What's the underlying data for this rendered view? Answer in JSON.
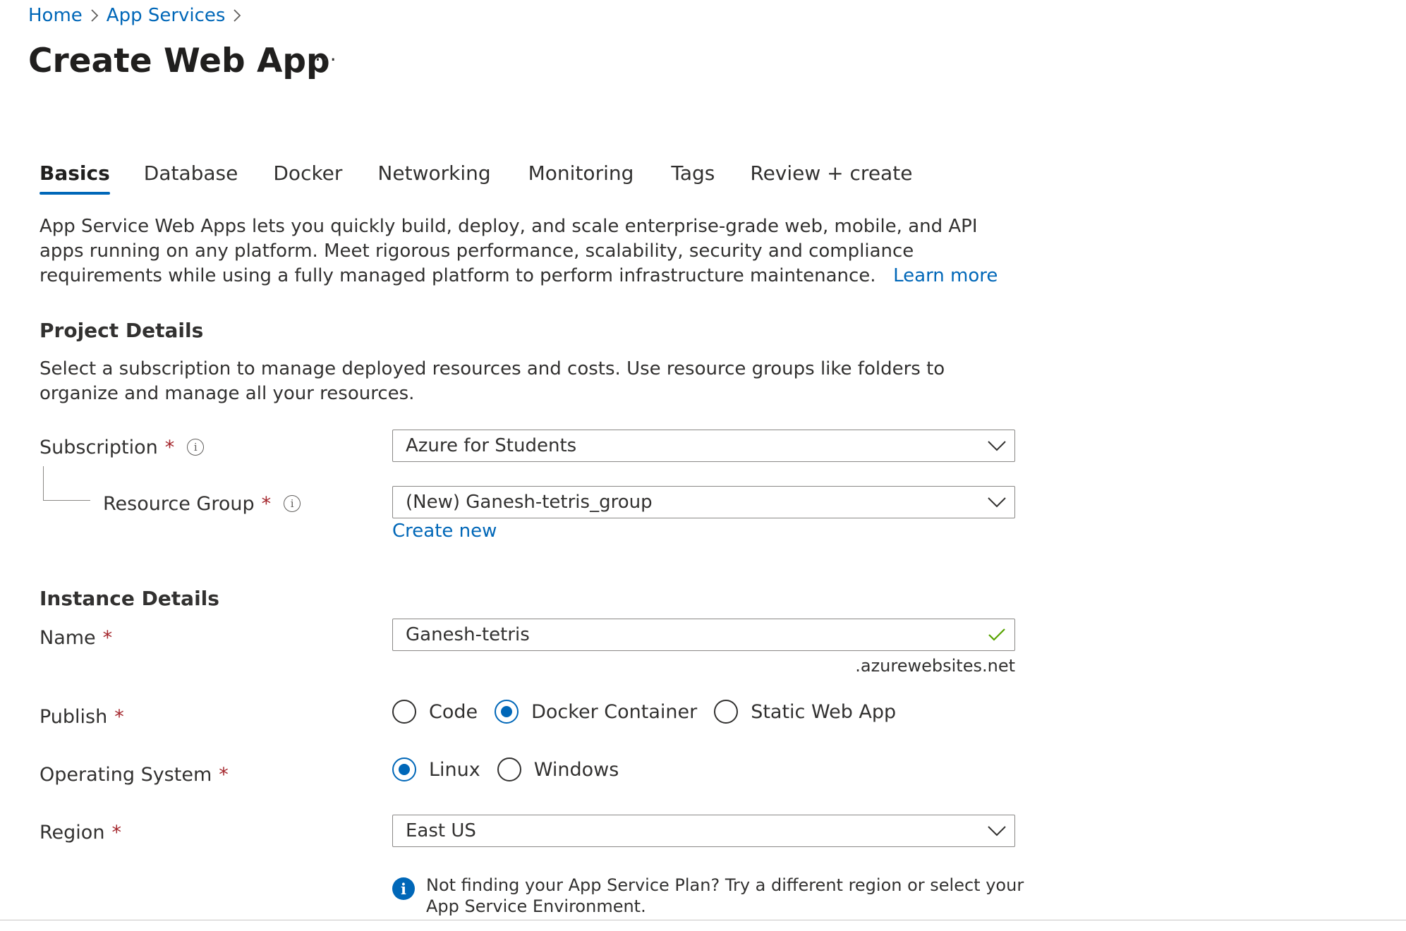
{
  "breadcrumb": {
    "home": "Home",
    "app_services": "App Services"
  },
  "page": {
    "title": "Create Web App",
    "more": "···"
  },
  "tabs": [
    {
      "label": "Basics",
      "active": true
    },
    {
      "label": "Database"
    },
    {
      "label": "Docker"
    },
    {
      "label": "Networking"
    },
    {
      "label": "Monitoring"
    },
    {
      "label": "Tags"
    },
    {
      "label": "Review + create"
    }
  ],
  "intro": {
    "text": "App Service Web Apps lets you quickly build, deploy, and scale enterprise-grade web, mobile, and API apps running on any platform. Meet rigorous performance, scalability, security and compliance requirements while using a fully managed platform to perform infrastructure maintenance.",
    "learn_more": "Learn more"
  },
  "project": {
    "heading": "Project Details",
    "description": "Select a subscription to manage deployed resources and costs. Use resource groups like folders to organize and manage all your resources.",
    "subscription": {
      "label": "Subscription",
      "required": "*",
      "value": "Azure for Students"
    },
    "resource_group": {
      "label": "Resource Group",
      "required": "*",
      "value": "(New) Ganesh-tetris_group",
      "create_new": "Create new"
    }
  },
  "instance": {
    "heading": "Instance Details",
    "name": {
      "label": "Name",
      "required": "*",
      "value": "Ganesh-tetris",
      "suffix": ".azurewebsites.net"
    },
    "publish": {
      "label": "Publish",
      "required": "*",
      "options": [
        "Code",
        "Docker Container",
        "Static Web App"
      ],
      "selected": "Docker Container"
    },
    "os": {
      "label": "Operating System",
      "required": "*",
      "options": [
        "Linux",
        "Windows"
      ],
      "selected": "Linux"
    },
    "region": {
      "label": "Region",
      "required": "*",
      "value": "East US"
    },
    "info_note": "Not finding your App Service Plan? Try a different region or select your App Service Environment."
  },
  "colors": {
    "accent": "#0067b8",
    "required": "#a4262c",
    "valid_check": "#57a300"
  },
  "icons": {
    "info": "info-circle-icon",
    "chevron": "chevron-down-icon",
    "check": "checkmark-icon"
  }
}
